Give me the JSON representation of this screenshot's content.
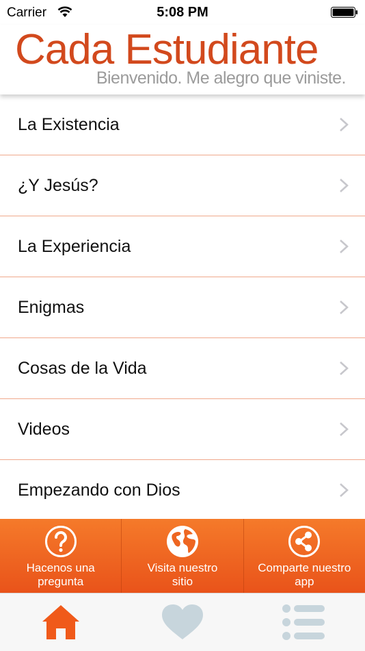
{
  "status_bar": {
    "carrier": "Carrier",
    "time": "5:08 PM"
  },
  "header": {
    "title": "Cada Estudiante",
    "subtitle": "Bienvenido. Me alegro que viniste."
  },
  "menu": {
    "items": [
      {
        "label": "La Existencia"
      },
      {
        "label": "¿Y Jesús?"
      },
      {
        "label": "La Experiencia"
      },
      {
        "label": "Enigmas"
      },
      {
        "label": "Cosas de la Vida"
      },
      {
        "label": "Videos"
      },
      {
        "label": "Empezando con Dios"
      }
    ]
  },
  "actions": [
    {
      "label": "Hacenos una\npregunta",
      "icon": "question-icon"
    },
    {
      "label": "Visita nuestro\nsitio",
      "icon": "globe-icon"
    },
    {
      "label": "Comparte nuestro\napp",
      "icon": "share-icon"
    }
  ],
  "tabs": [
    {
      "icon": "home-icon",
      "active": true
    },
    {
      "icon": "heart-icon",
      "active": false
    },
    {
      "icon": "list-icon",
      "active": false
    }
  ],
  "colors": {
    "brand_orange": "#d2491d",
    "action_orange": "#f07022",
    "separator": "#f0a88b",
    "tab_active": "#f05a1a",
    "tab_inactive": "#c7d5dc"
  }
}
